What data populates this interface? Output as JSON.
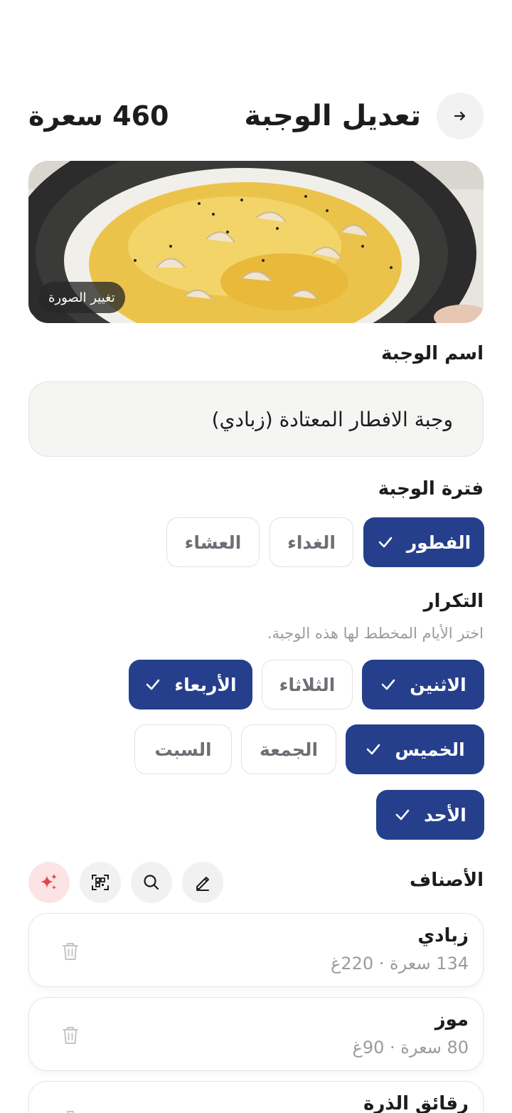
{
  "header": {
    "title": "تعديل الوجبة",
    "calories": "460 سعرة"
  },
  "photo": {
    "change_label": "تغيير الصورة"
  },
  "meal_name": {
    "label": "اسم الوجبة",
    "value": "وجبة الافطار المعتادة (زبادي)"
  },
  "meal_period": {
    "label": "فترة الوجبة",
    "options": [
      {
        "label": "الفطور",
        "selected": true
      },
      {
        "label": "الغداء",
        "selected": false
      },
      {
        "label": "العشاء",
        "selected": false
      }
    ]
  },
  "repeat": {
    "label": "التكرار",
    "hint": "اختر الأيام المخطط لها هذه الوجبة.",
    "days": [
      {
        "label": "الاثنين",
        "selected": true
      },
      {
        "label": "الثلاثاء",
        "selected": false
      },
      {
        "label": "الأربعاء",
        "selected": true
      },
      {
        "label": "الخميس",
        "selected": true
      },
      {
        "label": "الجمعة",
        "selected": false
      },
      {
        "label": "السبت",
        "selected": false
      },
      {
        "label": "الأحد",
        "selected": true
      }
    ]
  },
  "items_section": {
    "label": "الأصناف",
    "tools": [
      "pencil-icon",
      "search-icon",
      "qr-scan-icon",
      "sparkle-icon"
    ],
    "items": [
      {
        "name": "زبادي",
        "meta": "134 سعرة · 220غ"
      },
      {
        "name": "موز",
        "meta": "80 سعرة · 90غ"
      },
      {
        "name": "رقائق الذرة",
        "meta": ""
      }
    ]
  },
  "colors": {
    "accent": "#263f8c",
    "ai_button": "#fde4e4",
    "sparkle": "#e0484d"
  }
}
